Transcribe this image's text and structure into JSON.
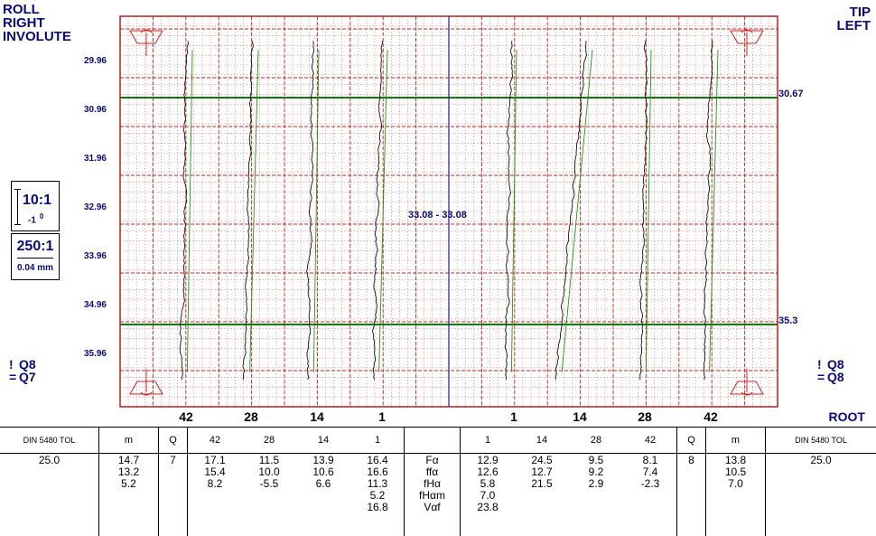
{
  "header": {
    "left": [
      "ROLL",
      "RIGHT",
      "INVOLUTE"
    ],
    "right": [
      "TIP",
      "LEFT"
    ]
  },
  "y_ticks": [
    "29.96",
    "30.96",
    "31.96",
    "32.96",
    "33.96",
    "34.96",
    "35.96"
  ],
  "scale": {
    "vertical_ratio": "10:1",
    "vertical_unit": "-1",
    "vertical_unit_sup": "0",
    "horizontal_ratio": "250:1",
    "horizontal_unit": "0.04 mm"
  },
  "quality_left": {
    "line1": "Q8",
    "line2": "Q7"
  },
  "quality_right": {
    "line1": "Q8",
    "line2": "Q8"
  },
  "reference_label": "33.08 - 33.08",
  "tolerance_top": "30.67",
  "tolerance_bottom": "35.3",
  "tooth_labels_left": [
    "42",
    "28",
    "14",
    "1"
  ],
  "tooth_labels_right": [
    "1",
    "14",
    "28",
    "42"
  ],
  "root_label": "ROOT",
  "colors": {
    "grid": "#d62020",
    "trace": "#111111",
    "nominal": "#1a9a1a",
    "tolerance_band": "#0f7a0f",
    "divider": "#1a1a9a"
  },
  "chart_data": {
    "type": "line",
    "title": "",
    "ylabel": "",
    "y_range": [
      29.46,
      36.46
    ],
    "tolerance_lines": [
      30.67,
      35.3
    ],
    "flanks": [
      {
        "side": "right",
        "tooth": "42"
      },
      {
        "side": "right",
        "tooth": "28"
      },
      {
        "side": "right",
        "tooth": "14"
      },
      {
        "side": "right",
        "tooth": "1"
      },
      {
        "side": "left",
        "tooth": "1"
      },
      {
        "side": "left",
        "tooth": "14"
      },
      {
        "side": "left",
        "tooth": "28"
      },
      {
        "side": "left",
        "tooth": "42"
      }
    ]
  },
  "table": {
    "columns": [
      {
        "name": "din-left",
        "header": "DIN 5480 TOL",
        "values": [
          "25.0"
        ]
      },
      {
        "name": "m-left",
        "header": "m",
        "values": [
          "14.7",
          "13.2",
          "5.2"
        ]
      },
      {
        "name": "q-left",
        "header": "Q",
        "values": [
          "7"
        ]
      },
      {
        "name": "t42-left",
        "header": "42",
        "values": [
          "17.1",
          "15.4",
          "8.2"
        ]
      },
      {
        "name": "t28-left",
        "header": "28",
        "values": [
          "11.5",
          "10.0",
          "-5.5"
        ]
      },
      {
        "name": "t14-left",
        "header": "14",
        "values": [
          "13.9",
          "10.6",
          "6.6"
        ]
      },
      {
        "name": "t1-left",
        "header": "1",
        "values": [
          "16.4",
          "16.6",
          "11.3",
          "5.2",
          "16.8"
        ]
      },
      {
        "name": "params",
        "header": "",
        "values": [
          "Fα",
          "ffα",
          "fHα",
          "fHαm",
          "Vαf"
        ]
      },
      {
        "name": "t1-right",
        "header": "1",
        "values": [
          "12.9",
          "12.6",
          "5.8",
          "7.0",
          "23.8"
        ]
      },
      {
        "name": "t14-right",
        "header": "14",
        "values": [
          "24.5",
          "12.7",
          "21.5"
        ]
      },
      {
        "name": "t28-right",
        "header": "28",
        "values": [
          "9.5",
          "9.2",
          "2.9"
        ]
      },
      {
        "name": "t42-right",
        "header": "42",
        "values": [
          "8.1",
          "7.4",
          "-2.3"
        ]
      },
      {
        "name": "q-right",
        "header": "Q",
        "values": [
          "8"
        ]
      },
      {
        "name": "m-right",
        "header": "m",
        "values": [
          "13.8",
          "10.5",
          "7.0"
        ]
      },
      {
        "name": "din-right",
        "header": "DIN 5480 TOL",
        "values": [
          "25.0"
        ]
      }
    ]
  }
}
